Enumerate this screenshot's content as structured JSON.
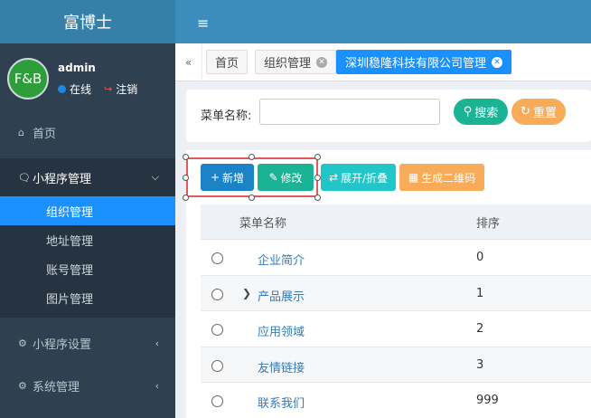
{
  "app": {
    "title": "富博士"
  },
  "user": {
    "avatar_text": "F&B",
    "name": "admin",
    "status": "在线",
    "logout": "注销"
  },
  "sidebar": {
    "items": [
      {
        "label": "首页",
        "icon": "home-icon"
      },
      {
        "label": "小程序管理",
        "icon": "wechat-icon",
        "open": true,
        "children": [
          {
            "label": "组织管理",
            "active": true
          },
          {
            "label": "地址管理"
          },
          {
            "label": "账号管理"
          },
          {
            "label": "图片管理"
          }
        ]
      },
      {
        "label": "小程序设置",
        "icon": "gears-icon"
      },
      {
        "label": "系统管理",
        "icon": "gear-icon"
      }
    ]
  },
  "tabs": [
    {
      "label": "首页"
    },
    {
      "label": "组织管理"
    },
    {
      "label": "深圳稳隆科技有限公司管理",
      "active": true
    }
  ],
  "search": {
    "label": "菜单名称:",
    "placeholder": "",
    "search_btn": "搜索",
    "reset_btn": "重置"
  },
  "toolbar": {
    "add": "新增",
    "edit": "修改",
    "toggle": "展开/折叠",
    "qrcode": "生成二维码"
  },
  "table": {
    "columns": [
      "菜单名称",
      "排序"
    ],
    "rows": [
      {
        "name": "企业简介",
        "sort": "0"
      },
      {
        "name": "产品展示",
        "sort": "1",
        "expandable": true
      },
      {
        "name": "应用领域",
        "sort": "2"
      },
      {
        "name": "友情链接",
        "sort": "3"
      },
      {
        "name": "联系我们",
        "sort": "999"
      }
    ]
  },
  "colors": {
    "sidebar_bg": "#2f4050",
    "header_bg": "#3c8dbc",
    "brand_bg": "#367fa9",
    "active_blue": "#1a91ff",
    "primary": "#1c84c6",
    "success": "#1ab394",
    "info": "#23c6c8",
    "warning": "#f8ac59",
    "highlight_border": "#e05a5a"
  }
}
